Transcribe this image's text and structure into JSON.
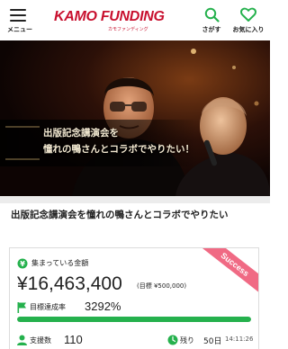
{
  "header": {
    "menu_label": "メニュー",
    "logo_text": "KAMO FUNDING",
    "logo_sub": "カモファンディング",
    "search_label": "さがす",
    "favorite_label": "お気に入り"
  },
  "hero": {
    "title_line1": "出版記念講演会を",
    "title_line2": "憧れの鴨さんとコラボでやりたい！"
  },
  "project": {
    "title": "出版記念講演会を憧れの鴨さんとコラボでやりたい"
  },
  "funding": {
    "ribbon": "Success",
    "raised_label": "集まっている金額",
    "amount": "¥16,463,400",
    "target": "(目標 ¥500,000)",
    "rate_label": "目標達成率",
    "rate_value": "3292%",
    "progress_fraction": 1.0,
    "supporters_label": "支援数",
    "supporters_value": "110",
    "remaining_label": "残り",
    "remaining_value": "50日",
    "remaining_time": "14:11:26"
  },
  "colors": {
    "brand": "#c8102e",
    "accent_green": "#25b14d",
    "ribbon_pink": "#f06a84"
  },
  "icons": {
    "menu": "hamburger-icon",
    "search": "search-icon",
    "favorite": "heart-icon",
    "raised": "coin-icon",
    "rate": "flag-icon",
    "supporters": "person-icon",
    "remaining": "clock-icon"
  }
}
